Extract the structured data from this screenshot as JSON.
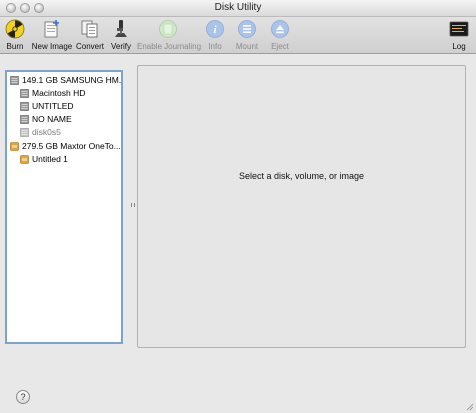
{
  "window": {
    "title": "Disk Utility"
  },
  "toolbar": {
    "items": [
      {
        "label": "Burn",
        "icon": "burn-icon",
        "enabled": true
      },
      {
        "label": "New Image",
        "icon": "new-image-icon",
        "enabled": true
      },
      {
        "label": "Convert",
        "icon": "convert-icon",
        "enabled": true
      },
      {
        "label": "Verify",
        "icon": "verify-icon",
        "enabled": true
      },
      {
        "label": "Enable Journaling",
        "icon": "enable-journaling-icon",
        "enabled": false
      },
      {
        "label": "Info",
        "icon": "info-icon",
        "enabled": false
      },
      {
        "label": "Mount",
        "icon": "mount-icon",
        "enabled": false
      },
      {
        "label": "Eject",
        "icon": "eject-icon",
        "enabled": false
      },
      {
        "label": "Log",
        "icon": "log-icon",
        "enabled": true
      }
    ]
  },
  "sidebar": {
    "items": [
      {
        "label": "149.1 GB SAMSUNG HM...",
        "kind": "disk",
        "level": 0
      },
      {
        "label": "Macintosh HD",
        "kind": "volume",
        "level": 1
      },
      {
        "label": "UNTITLED",
        "kind": "volume",
        "level": 1
      },
      {
        "label": "NO NAME",
        "kind": "volume",
        "level": 1
      },
      {
        "label": "disk0s5",
        "kind": "volume",
        "level": 1,
        "dimmed": true
      },
      {
        "label": "279.5 GB Maxtor OneTo...",
        "kind": "external-disk",
        "level": 0
      },
      {
        "label": "Untitled 1",
        "kind": "external-volume",
        "level": 1
      }
    ]
  },
  "main": {
    "prompt": "Select a disk, volume, or image"
  },
  "footer": {
    "help_symbol": "?"
  },
  "colors": {
    "selection_border": "#7da2ce",
    "external_disk": "#e3a33b",
    "disabled_text": "#8b8b8b"
  }
}
